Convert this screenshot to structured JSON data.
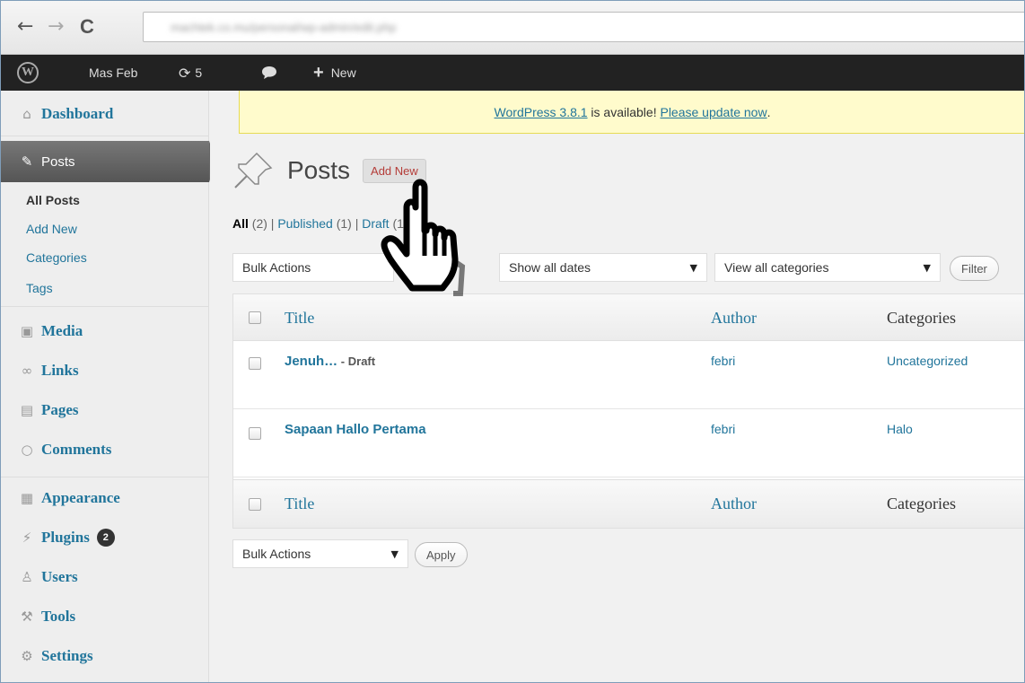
{
  "browser": {
    "back": "←",
    "forward": "→",
    "reload": "C",
    "url": "machtek.co.mu/personal/wp-admin/edit.php"
  },
  "adminbar": {
    "site_name": "Mas Feb",
    "updates_count": "5",
    "new_label": "New"
  },
  "notice": {
    "version_link": "WordPress 3.8.1",
    "middle": " is available! ",
    "update_link": "Please update now",
    "end": "."
  },
  "sidebar": {
    "dashboard": "Dashboard",
    "posts": "Posts",
    "sub": [
      "All Posts",
      "Add New",
      "Categories",
      "Tags"
    ],
    "media": "Media",
    "links": "Links",
    "pages": "Pages",
    "comments": "Comments",
    "appearance": "Appearance",
    "plugins": "Plugins",
    "plugins_badge": "2",
    "users": "Users",
    "tools": "Tools",
    "settings": "Settings"
  },
  "page": {
    "title": "Posts",
    "add_new": "Add New",
    "filters": {
      "all": "All",
      "all_count": " (2)",
      "sep1": " | ",
      "published": "Published",
      "published_count": " (1)",
      "sep2": " | ",
      "draft": "Draft",
      "draft_count": " (1)"
    },
    "bulk_actions": "Bulk Actions",
    "show_all_dates": "Show all dates",
    "view_all_categories": "View all categories",
    "filter_btn": "Filter",
    "apply_btn": "Apply"
  },
  "table": {
    "headers": {
      "title": "Title",
      "author": "Author",
      "categories": "Categories"
    },
    "rows": [
      {
        "title": "Jenuh…",
        "state": " - Draft",
        "author": "febri",
        "category": "Uncategorized"
      },
      {
        "title": "Sapaan Hallo Pertama",
        "state": "",
        "author": "febri",
        "category": "Halo"
      }
    ]
  },
  "colors": {
    "link": "#21759b",
    "adminbar": "#222222",
    "notice_bg": "#fffbcc",
    "add_new_text": "#b43c38"
  }
}
